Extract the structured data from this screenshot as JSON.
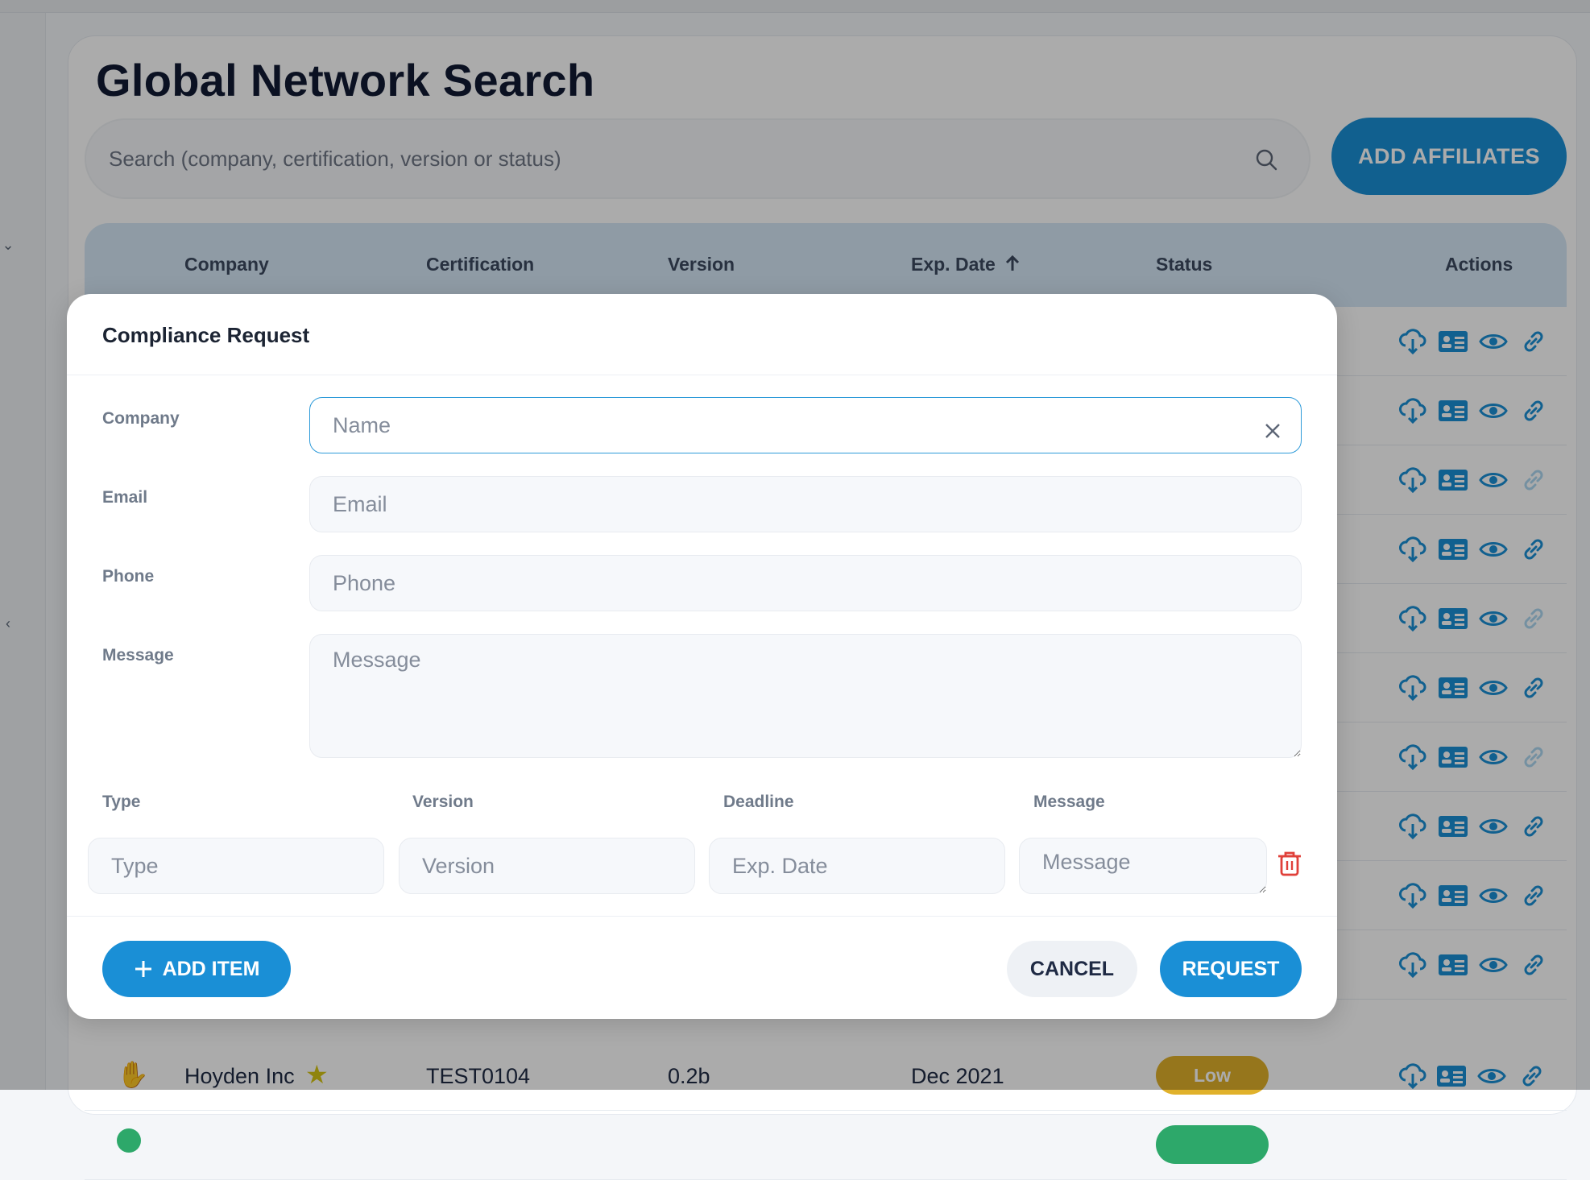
{
  "page": {
    "title": "Global Network Search",
    "search_placeholder": "Search (company, certification, version or status)",
    "add_affiliates_label": "ADD AFFILIATES"
  },
  "table": {
    "columns": [
      "Company",
      "Certification",
      "Version",
      "Exp. Date",
      "Status",
      "Actions"
    ],
    "sort_column": "Exp. Date",
    "sort_direction": "ascending",
    "visible_row": {
      "company": "Hoyden Inc",
      "certification": "TEST0104",
      "version": "0.2b",
      "exp_date": "Dec 2021",
      "status": "Low",
      "status_color": "#e0b12b"
    },
    "action_icons": [
      "cloud-download-icon",
      "contact-card-icon",
      "eye-icon",
      "link-icon"
    ]
  },
  "modal": {
    "title": "Compliance Request",
    "labels": {
      "company": "Company",
      "email": "Email",
      "phone": "Phone",
      "message": "Message"
    },
    "placeholders": {
      "company": "Name",
      "email": "Email",
      "phone": "Phone",
      "message": "Message"
    },
    "item": {
      "labels": {
        "type": "Type",
        "version": "Version",
        "deadline": "Deadline",
        "message": "Message"
      },
      "placeholders": {
        "type": "Type",
        "version": "Version",
        "deadline": "Exp. Date",
        "message": "Message"
      }
    },
    "buttons": {
      "add_item": "ADD ITEM",
      "cancel": "CANCEL",
      "request": "REQUEST"
    }
  },
  "colors": {
    "primary": "#1a8fd6",
    "danger": "#e0403a",
    "table_header": "#d6e8f6"
  }
}
